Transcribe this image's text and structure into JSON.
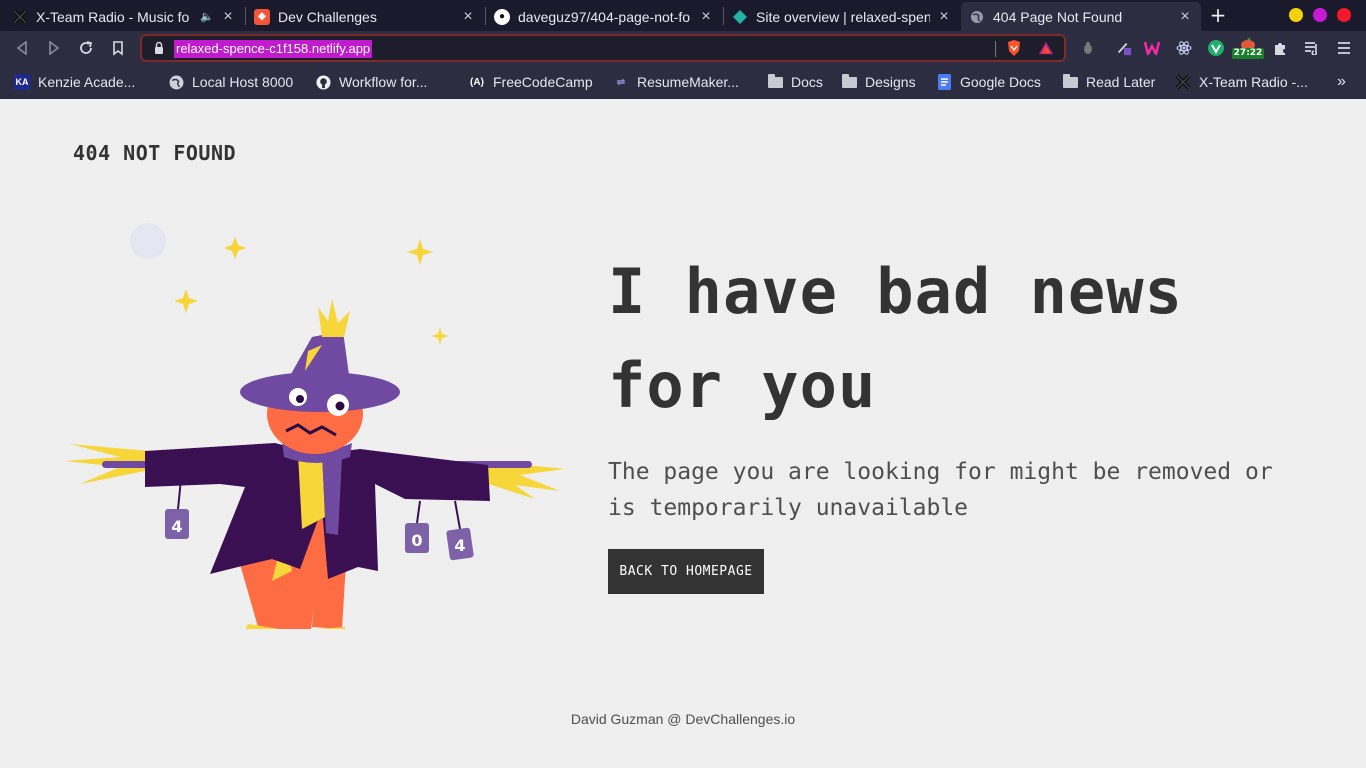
{
  "browser": {
    "tabs": [
      {
        "title": "X-Team Radio - Music fo",
        "favicon": "x-team-icon",
        "audio": true
      },
      {
        "title": "Dev Challenges",
        "favicon": "devchallenges-icon"
      },
      {
        "title": "daveguz97/404-page-not-fo",
        "favicon": "github-icon"
      },
      {
        "title": "Site overview | relaxed-spen",
        "favicon": "netlify-icon"
      },
      {
        "title": "404 Page Not Found",
        "favicon": "globe-icon",
        "active": true
      }
    ],
    "url": "relaxed-spence-c1f158.netlify.app",
    "extension_badge": "27:22",
    "bookmarks": [
      {
        "label": "Kenzie Acade...",
        "icon": "kenzie-icon"
      },
      {
        "label": "Local Host 8000",
        "icon": "globe-icon"
      },
      {
        "label": "Workflow for...",
        "icon": "github-icon"
      },
      {
        "label": "FreeCodeCamp",
        "icon": "freecodecamp-icon"
      },
      {
        "label": "ResumeMaker...",
        "icon": "resumemaker-icon"
      },
      {
        "label": "Docs",
        "icon": "folder-icon"
      },
      {
        "label": "Designs",
        "icon": "folder-icon"
      },
      {
        "label": "Google Docs",
        "icon": "google-docs-icon"
      },
      {
        "label": "Read Later",
        "icon": "folder-icon"
      },
      {
        "label": "X-Team Radio -...",
        "icon": "x-team-icon"
      }
    ],
    "more_bookmarks": "»"
  },
  "page": {
    "brand": "404 NOT FOUND",
    "headline": "I have bad news for you",
    "subtext": "The page you are looking for might be removed or is temporarily unavailable",
    "cta_label": "BACK TO HOMEPAGE",
    "illustration_tags": [
      "4",
      "0",
      "4"
    ],
    "footer": "David Guzman @ DevChallenges.io"
  },
  "colors": {
    "accent_highlight": "#c01ccd",
    "text_dark": "#333333",
    "button_bg": "#333333",
    "scarecrow_purple": "#3a1053",
    "scarecrow_orange": "#fd6c43",
    "straw_yellow": "#f8d722"
  }
}
